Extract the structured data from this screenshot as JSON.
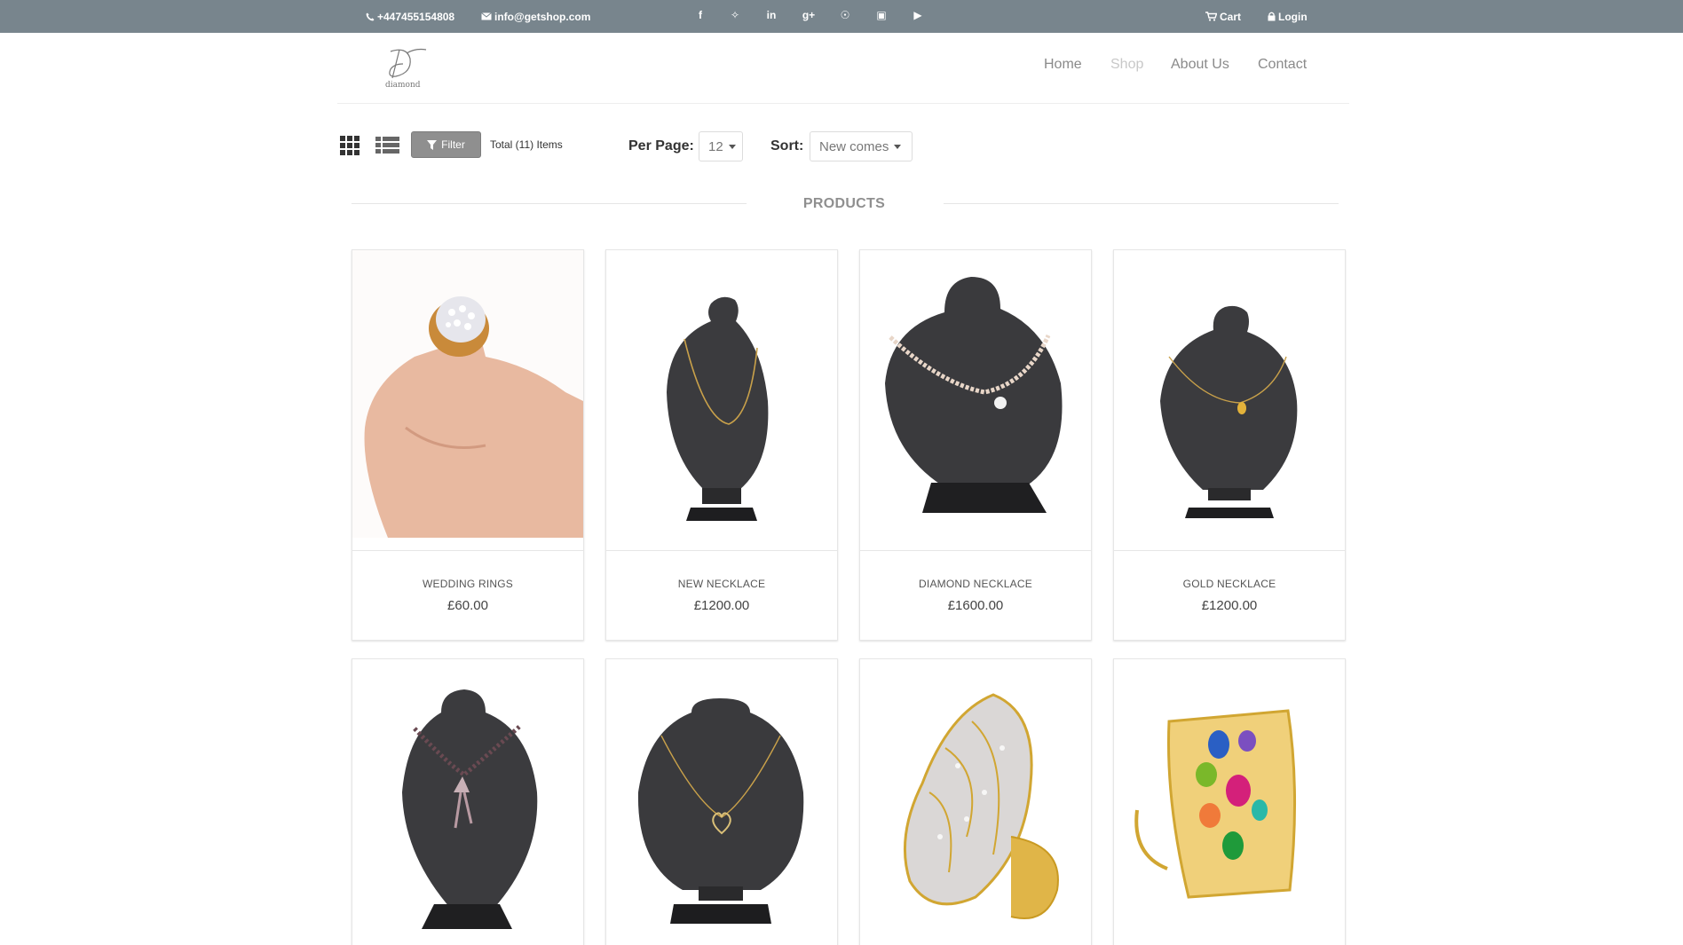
{
  "topbar": {
    "phone": "+447455154808",
    "email": "info@getshop.com",
    "social": [
      "facebook-icon",
      "twitter-icon",
      "linkedin-icon",
      "google-plus-icon",
      "pinterest-icon",
      "instagram-icon",
      "youtube-icon"
    ],
    "social_glyphs": [
      "f",
      "✧",
      "in",
      "g+",
      "☉",
      "▣",
      "▶"
    ],
    "cart_label": "Cart",
    "login_label": "Login",
    "bg_color": "#78858d"
  },
  "brand": {
    "logo_text": "diamond"
  },
  "nav": {
    "items": [
      "Home",
      "Shop",
      "About Us",
      "Contact"
    ],
    "active": "Shop"
  },
  "toolbar": {
    "filter_label": "Filter",
    "total_text": "Total (11) Items",
    "per_page_label": "Per Page:",
    "per_page_value": "12",
    "sort_label": "Sort:",
    "sort_value": "New comes"
  },
  "section": {
    "title": "PRODUCTS"
  },
  "products": [
    {
      "name": "WEDDING RINGS",
      "price": "£60.00",
      "image": "hand-holding-ring"
    },
    {
      "name": "NEW NECKLACE",
      "price": "£1200.00",
      "image": "gold-chain-necklace"
    },
    {
      "name": "DIAMOND NECKLACE",
      "price": "£1600.00",
      "image": "diamond-necklace"
    },
    {
      "name": "GOLD NECKLACE",
      "price": "£1200.00",
      "image": "gold-pendant-necklace"
    },
    {
      "name": "",
      "price": "",
      "image": "beaded-bow-necklace"
    },
    {
      "name": "",
      "price": "",
      "image": "heart-pendant-necklace"
    },
    {
      "name": "",
      "price": "",
      "image": "gold-diamond-ring"
    },
    {
      "name": "",
      "price": "",
      "image": "gemstone-ring"
    }
  ]
}
